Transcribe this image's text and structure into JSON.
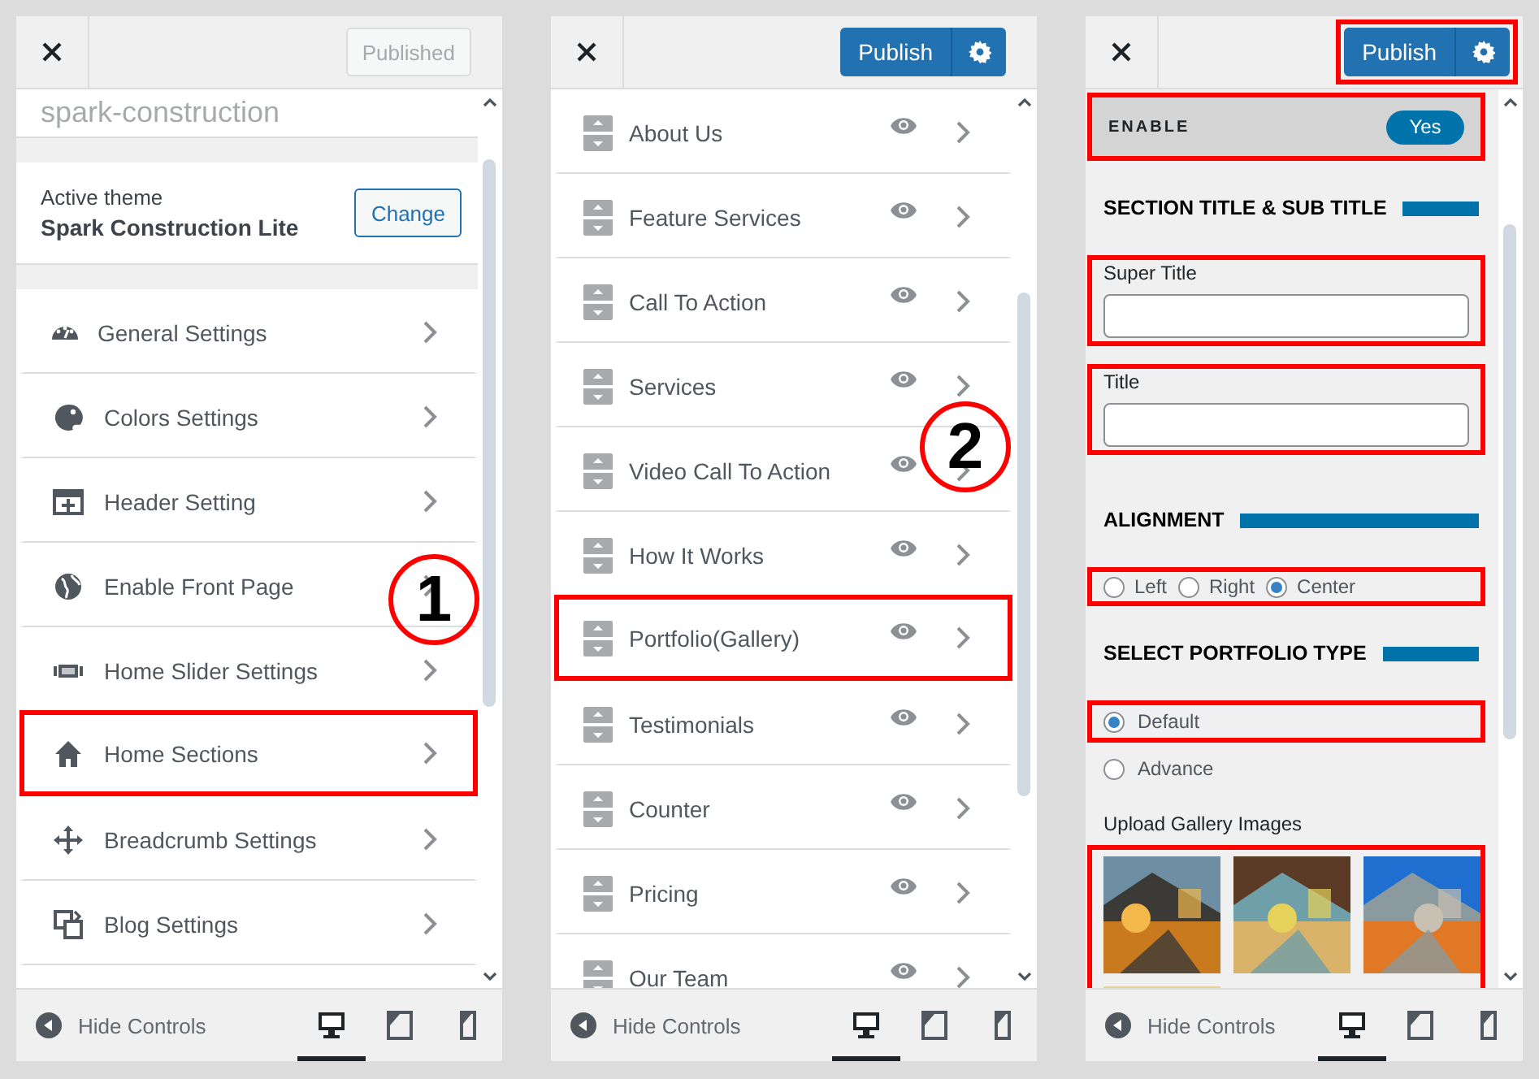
{
  "panels": [
    {
      "kind": "menu",
      "publish": {
        "label": "Published",
        "disabled": true,
        "has_settings": false,
        "highlighted": false
      },
      "site_title": "spark-construction",
      "theme": {
        "caption": "Active theme",
        "name": "Spark Construction Lite",
        "button": "Change"
      },
      "items": [
        {
          "label": "General Settings",
          "highlighted": false
        },
        {
          "label": "Colors Settings",
          "highlighted": false
        },
        {
          "label": "Header Setting",
          "highlighted": false
        },
        {
          "label": "Enable Front Page",
          "highlighted": false
        },
        {
          "label": "Home Slider Settings",
          "highlighted": false
        },
        {
          "label": "Home Sections",
          "highlighted": true
        },
        {
          "label": "Breadcrumb Settings",
          "highlighted": false
        },
        {
          "label": "Blog Settings",
          "highlighted": false
        }
      ],
      "callout": "1",
      "footer": {
        "label": "Hide Controls",
        "devices": [
          {
            "selected": true
          },
          {
            "selected": false
          },
          {
            "selected": false
          }
        ]
      }
    },
    {
      "kind": "sections",
      "publish": {
        "label": "Publish",
        "disabled": false,
        "has_settings": true,
        "highlighted": false
      },
      "items": [
        {
          "label": "About Us",
          "highlighted": false
        },
        {
          "label": "Feature Services",
          "highlighted": false
        },
        {
          "label": "Call To Action",
          "highlighted": false
        },
        {
          "label": "Services",
          "highlighted": false
        },
        {
          "label": "Video Call To Action",
          "highlighted": false
        },
        {
          "label": "How It Works",
          "highlighted": false
        },
        {
          "label": "Portfolio(Gallery)",
          "highlighted": true
        },
        {
          "label": "Testimonials",
          "highlighted": false
        },
        {
          "label": "Counter",
          "highlighted": false
        },
        {
          "label": "Pricing",
          "highlighted": false
        },
        {
          "label": "Our Team",
          "highlighted": false
        }
      ],
      "callout": "2",
      "footer": {
        "label": "Hide Controls",
        "devices": [
          {
            "selected": true
          },
          {
            "selected": false
          },
          {
            "selected": false
          }
        ]
      }
    },
    {
      "kind": "form",
      "publish": {
        "label": "Publish",
        "disabled": false,
        "has_settings": true,
        "highlighted": true
      },
      "enable": {
        "label": "ENABLE",
        "value": "Yes",
        "on": true,
        "highlighted": true
      },
      "blocks": [
        {
          "kind": "heading",
          "text": "SECTION TITLE & SUB TITLE"
        },
        {
          "kind": "field",
          "label": "Super Title",
          "highlighted": true
        },
        {
          "kind": "field",
          "label": "Title",
          "highlighted": true
        },
        {
          "kind": "heading",
          "text": "ALIGNMENT"
        },
        {
          "kind": "radio-row",
          "highlighted": true,
          "options": [
            {
              "label": "Left",
              "selected": false
            },
            {
              "label": "Right",
              "selected": false
            },
            {
              "label": "Center",
              "selected": true
            }
          ]
        },
        {
          "kind": "heading",
          "text": "SELECT PORTFOLIO TYPE"
        },
        {
          "kind": "radio",
          "label": "Default",
          "selected": true,
          "highlighted": true
        },
        {
          "kind": "radio",
          "label": "Advance",
          "selected": false,
          "highlighted": false
        },
        {
          "kind": "label",
          "text": "Upload Gallery Images"
        },
        {
          "kind": "gallery",
          "highlighted": true
        }
      ],
      "footer": {
        "label": "Hide Controls",
        "devices": [
          {
            "selected": true
          },
          {
            "selected": false
          },
          {
            "selected": false
          }
        ]
      }
    }
  ]
}
